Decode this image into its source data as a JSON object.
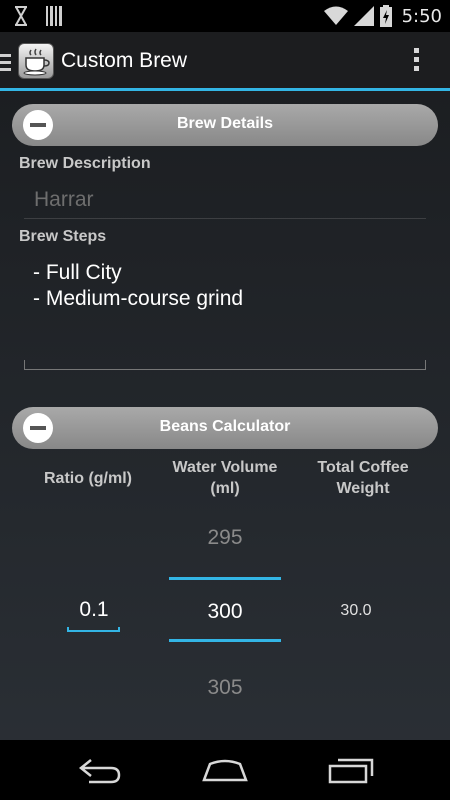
{
  "status_bar": {
    "time": "5:50",
    "icons": [
      "hourglass-icon",
      "barcode-icon",
      "wifi-icon",
      "signal-icon",
      "battery-icon"
    ]
  },
  "action_bar": {
    "title": "Custom Brew",
    "app_icon": "coffee-cup-icon",
    "overflow_icon": "overflow-menu-icon"
  },
  "brew_details": {
    "section_title": "Brew Details",
    "description_label": "Brew Description",
    "description_value": "Harrar",
    "steps_label": "Brew Steps",
    "steps_value": "- Full City\n- Medium-course grind"
  },
  "beans_calculator": {
    "section_title": "Beans Calculator",
    "ratio_header": "Ratio (g/ml)",
    "water_header_line1": "Water Volume",
    "water_header_line2": "(ml)",
    "total_header_line1": "Total Coffee",
    "total_header_line2": "Weight",
    "ratio_value": "0.1",
    "water_prev": "295",
    "water_value": "300",
    "water_next": "305",
    "total_value": "30.0"
  },
  "nav_bar": {
    "icons": [
      "back-icon",
      "home-icon",
      "recent-apps-icon"
    ]
  },
  "colors": {
    "accent": "#33b5e5",
    "section_bar": "#999999",
    "background": "#1f2226"
  }
}
